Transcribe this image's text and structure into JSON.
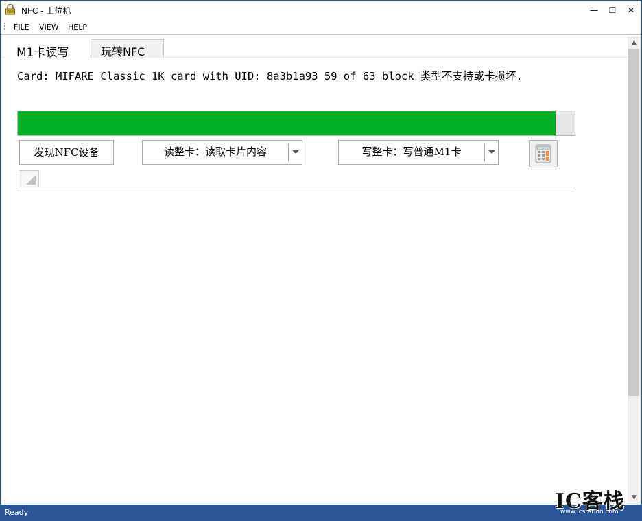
{
  "window": {
    "title": "NFC - 上位机",
    "controls": {
      "minimize": "—",
      "maximize": "☐",
      "close": "✕"
    }
  },
  "menu": {
    "items": [
      "FILE",
      "VIEW",
      "HELP"
    ]
  },
  "tabs": [
    {
      "label": "M1卡读写",
      "active": true
    },
    {
      "label": "玩转NFC",
      "active": false
    }
  ],
  "main": {
    "card_status": "Card: MIFARE Classic 1K card with UID: 8a3b1a93 59 of 63 block 类型不支持或卡损坏.",
    "progress": {
      "value": 0.965,
      "color": "#06b025"
    },
    "discover_button": "发现NFC设备",
    "read_combo": {
      "selected": "读整卡：读取卡片内容"
    },
    "write_combo": {
      "selected": "写整卡：写普通M1卡"
    },
    "calculator_icon": "calculator-icon"
  },
  "scrollbar": {
    "up": "▲",
    "down": "▼"
  },
  "statusbar": {
    "text": "Ready"
  },
  "watermark": {
    "text": "IC客栈",
    "subtext": "www.icstation.com"
  }
}
